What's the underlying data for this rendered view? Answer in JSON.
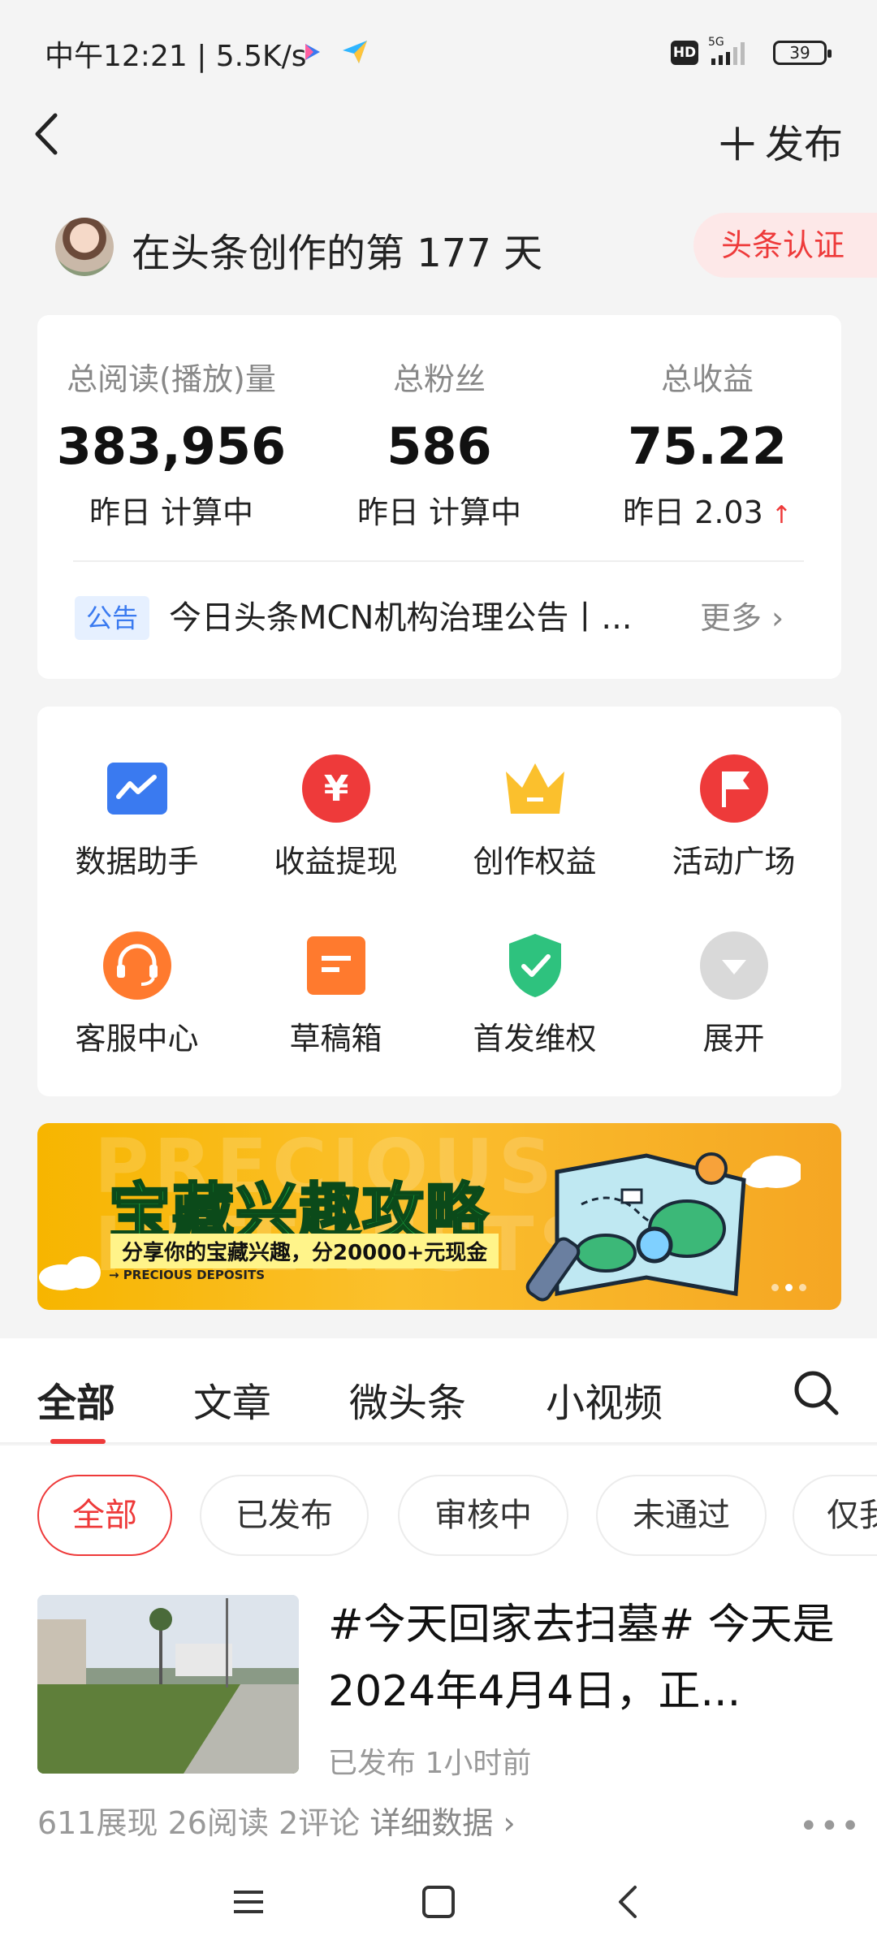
{
  "status_bar": {
    "time": "中午12:21 | 5.5K/s",
    "hd": "HD",
    "network": "5G",
    "battery": "39"
  },
  "nav": {
    "publish_label": "发布"
  },
  "creator": {
    "days_text": "在头条创作的第 177 天",
    "badge": "头条认证"
  },
  "stats": [
    {
      "label": "总阅读(播放)量",
      "value": "383,956",
      "sub": "昨日 计算中"
    },
    {
      "label": "总粉丝",
      "value": "586",
      "sub": "昨日 计算中"
    },
    {
      "label": "总收益",
      "value": "75.22",
      "sub": "昨日 2.03"
    }
  ],
  "notice": {
    "tag": "公告",
    "text": "今日头条MCN机构治理公告丨...",
    "more": "更多"
  },
  "tools": [
    {
      "label": "数据助手",
      "icon": "chart-icon"
    },
    {
      "label": "收益提现",
      "icon": "yuan-icon"
    },
    {
      "label": "创作权益",
      "icon": "crown-icon"
    },
    {
      "label": "活动广场",
      "icon": "flag-icon"
    },
    {
      "label": "客服中心",
      "icon": "headset-icon"
    },
    {
      "label": "草稿箱",
      "icon": "draft-icon"
    },
    {
      "label": "首发维权",
      "icon": "shield-icon"
    },
    {
      "label": "展开",
      "icon": "expand-icon"
    }
  ],
  "banner": {
    "title": "宝藏兴趣攻略",
    "subtitle": "分享你的宝藏兴趣，分20000+元现金",
    "small": "PRECIOUS DEPOSITS",
    "ghost": "PRECIOUS",
    "ghost2": "INTERESTS"
  },
  "tabs": [
    "全部",
    "文章",
    "微头条",
    "小视频"
  ],
  "filters": [
    "全部",
    "已发布",
    "审核中",
    "未通过",
    "仅我"
  ],
  "post": {
    "title": "#今天回家去扫墓# 今天是2024年4月4日，正...",
    "status": "已发布",
    "time": "1小时前",
    "impressions": "611展现",
    "reads": "26阅读",
    "comments": "2评论",
    "detail": "详细数据"
  },
  "colors": {
    "accent_red": "#ee3a3a",
    "blue": "#3a7af0",
    "orange": "#ff7a2e",
    "gold": "#fbc02d",
    "green": "#2ec27e"
  }
}
